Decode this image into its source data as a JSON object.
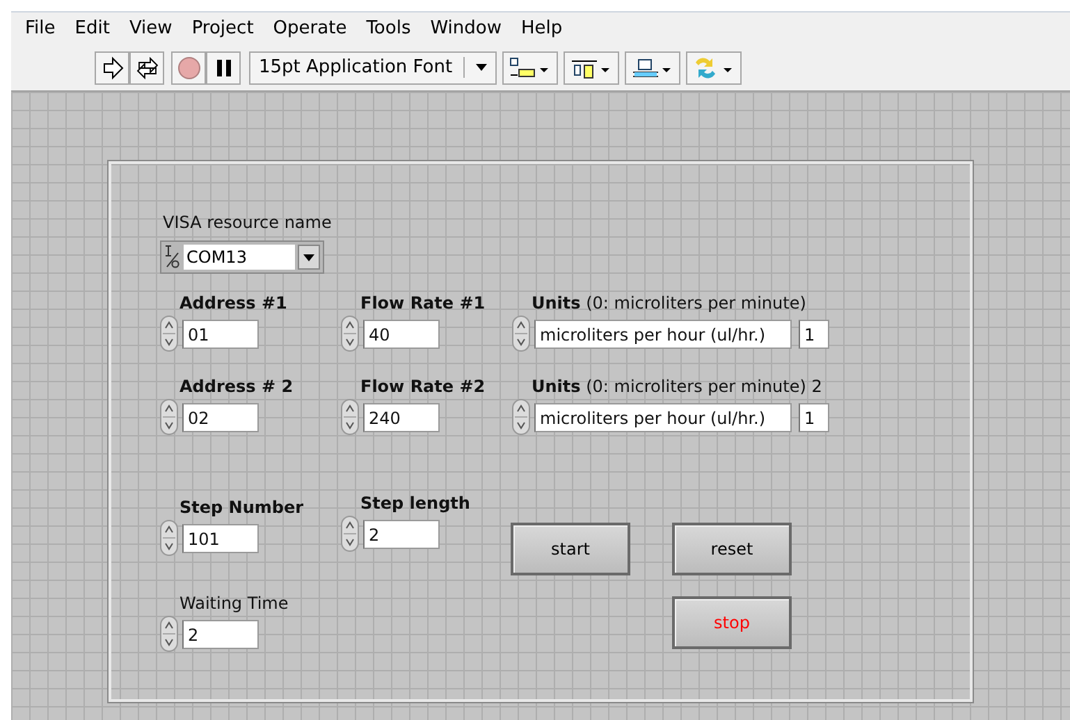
{
  "menu": [
    "File",
    "Edit",
    "View",
    "Project",
    "Operate",
    "Tools",
    "Window",
    "Help"
  ],
  "toolbar": {
    "font": "15pt Application Font"
  },
  "controls": [
    {
      "kind": "visa",
      "label": "VISA resource name",
      "value": "COM13"
    },
    {
      "kind": "numeric",
      "label": "Address #1",
      "value": "01",
      "bold": true
    },
    {
      "kind": "numeric",
      "label": "Flow Rate #1",
      "value": "40",
      "bold": true
    },
    {
      "kind": "ring",
      "label": "**Units** (0: microliters per minute)",
      "value": "microliters per hour (ul/hr.)",
      "index": "1"
    },
    {
      "kind": "numeric",
      "label": "Address # 2",
      "value": "02",
      "bold": true
    },
    {
      "kind": "numeric",
      "label": "Flow Rate #2",
      "value": "240",
      "bold": true
    },
    {
      "kind": "ring",
      "label": "**Units** (0: microliters per minute) 2",
      "value": "microliters per hour (ul/hr.)",
      "index": "1"
    },
    {
      "kind": "numeric",
      "label": "Step Number",
      "value": "101",
      "bold": true
    },
    {
      "kind": "numeric",
      "label": "Step length",
      "value": "2",
      "bold": true
    },
    {
      "kind": "numeric",
      "label": "Waiting Time",
      "value": "2",
      "bold": false
    },
    {
      "kind": "button",
      "text": "start",
      "color": "#000000"
    },
    {
      "kind": "button",
      "text": "reset",
      "color": "#000000"
    },
    {
      "kind": "button",
      "text": "stop",
      "color": "#ff0000"
    }
  ]
}
